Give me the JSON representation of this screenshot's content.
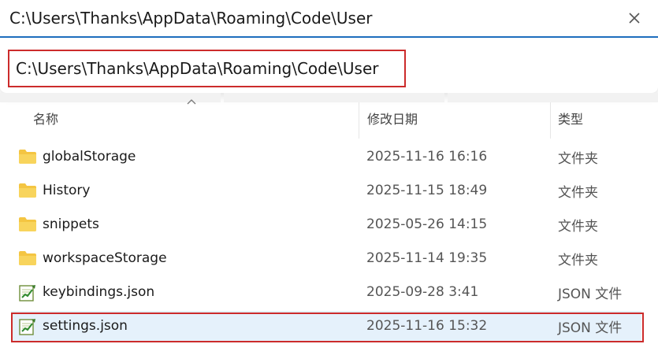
{
  "address_bar": {
    "path": "C:\\Users\\Thanks\\AppData\\Roaming\\Code\\User"
  },
  "suggestion": {
    "path": "C:\\Users\\Thanks\\AppData\\Roaming\\Code\\User"
  },
  "columns": {
    "name": "名称",
    "date": "修改日期",
    "type": "类型"
  },
  "files": [
    {
      "name": "globalStorage",
      "date": "2025-11-16 16:16",
      "type": "文件夹",
      "icon": "folder-icon"
    },
    {
      "name": "History",
      "date": "2025-11-15 18:49",
      "type": "文件夹",
      "icon": "folder-icon"
    },
    {
      "name": "snippets",
      "date": "2025-05-26 14:15",
      "type": "文件夹",
      "icon": "folder-icon"
    },
    {
      "name": "workspaceStorage",
      "date": "2025-11-14 19:35",
      "type": "文件夹",
      "icon": "folder-icon"
    },
    {
      "name": "keybindings.json",
      "date": "2025-09-28 3:41",
      "type": "JSON 文件",
      "icon": "json-file-icon"
    },
    {
      "name": "settings.json",
      "date": "2025-11-16 15:32",
      "type": "JSON 文件",
      "icon": "json-file-icon",
      "selected": true
    }
  ],
  "colors": {
    "accent": "#1f6fbf",
    "highlight_box": "#cc2b2b",
    "selection": "#e5f1fb",
    "folder": "#f4c542"
  }
}
